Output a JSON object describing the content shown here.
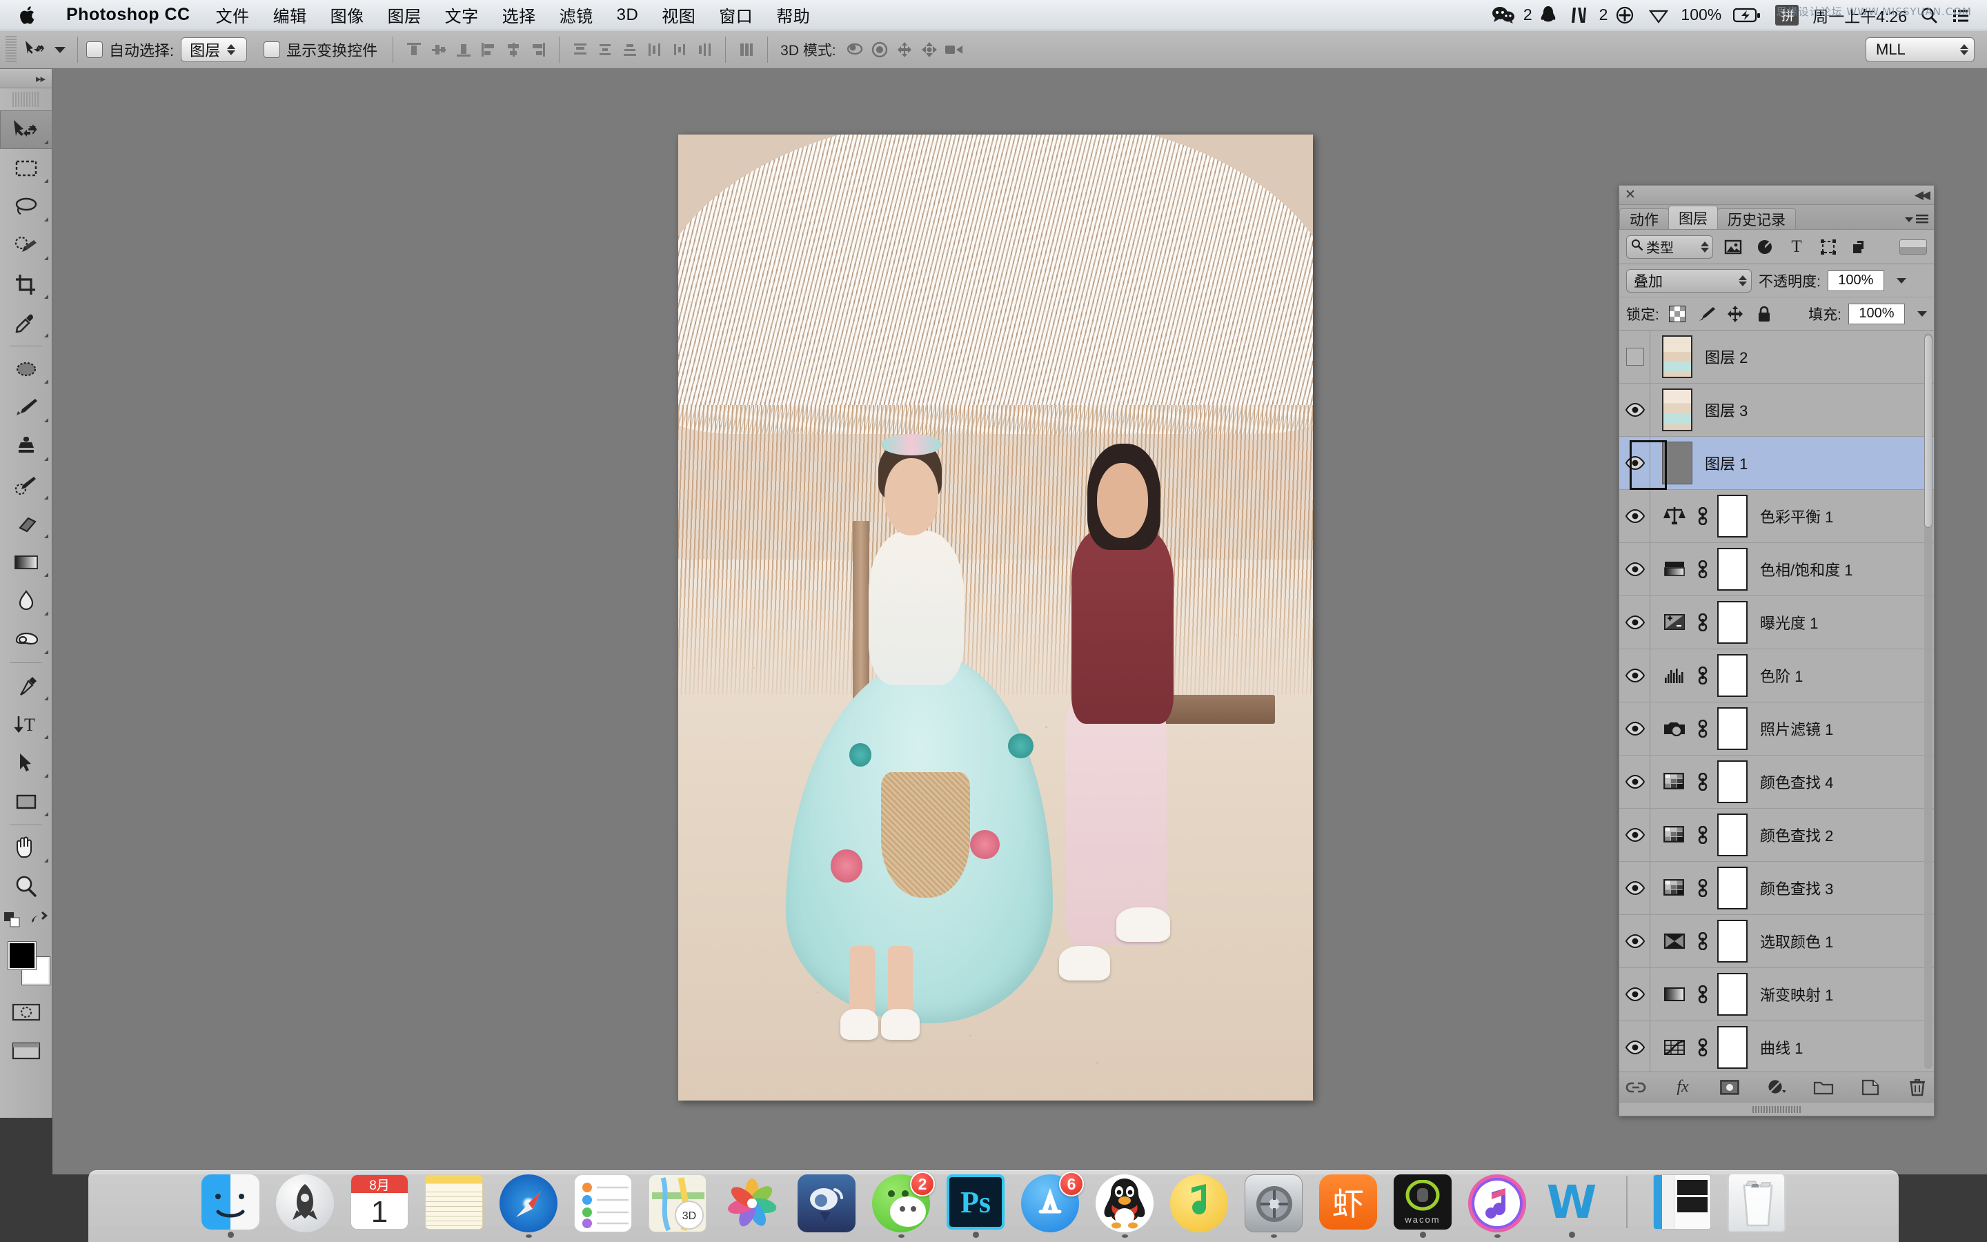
{
  "menubar": {
    "apple_icon": "apple-logo-icon",
    "app_name": "Photoshop CC",
    "menus": [
      "文件",
      "编辑",
      "图像",
      "图层",
      "文字",
      "选择",
      "滤镜",
      "3D",
      "视图",
      "窗口",
      "帮助"
    ],
    "status_items": [
      {
        "icon": "wechat-icon",
        "badge": "2"
      },
      {
        "icon": "bell-icon",
        "badge": ""
      },
      {
        "icon": "sogou-input-icon",
        "badge": "2"
      },
      {
        "icon": "plus-circle-icon",
        "badge": ""
      },
      {
        "icon": "dropbox-icon",
        "badge": ""
      }
    ],
    "battery_percent": "100%",
    "battery_icon": "battery-charging-icon",
    "input_method": "拼",
    "clock": "周一上午4:26",
    "search_icon": "spotlight-search-icon",
    "notification_icon": "notification-center-icon",
    "watermark": "思缘设计论坛 WWW.MISSYUAN.COM"
  },
  "optionsbar": {
    "tool_icon": "move-tool-icon",
    "auto_select_label": "自动选择:",
    "auto_select_value": "图层",
    "show_transform_label": "显示变换控件",
    "align_icons": [
      "align-top-edges-icon",
      "align-vertical-centers-icon",
      "align-bottom-edges-icon",
      "align-left-edges-icon",
      "align-horizontal-centers-icon",
      "align-right-edges-icon"
    ],
    "distribute_icons": [
      "distribute-top-edges-icon",
      "distribute-vertical-centers-icon",
      "distribute-bottom-edges-icon",
      "distribute-left-edges-icon",
      "distribute-horizontal-centers-icon",
      "distribute-right-edges-icon"
    ],
    "auto_align_icon": "auto-align-layers-icon",
    "mode3d_label": "3D 模式:",
    "mode3d_icons": [
      "rotate-3d-icon",
      "roll-3d-icon",
      "pan-3d-icon",
      "slide-3d-icon",
      "scale-3d-icon"
    ],
    "workspace_value": "MLL"
  },
  "toolbar": {
    "collapse_icon": "double-chevron-right-icon",
    "tools": [
      {
        "name": "move-tool",
        "icon": "move-tool-icon",
        "selected": true
      },
      {
        "name": "marquee-tool",
        "icon": "rectangular-marquee-icon",
        "selected": false
      },
      {
        "name": "lasso-tool",
        "icon": "lasso-icon",
        "selected": false
      },
      {
        "name": "quick-selection-tool",
        "icon": "quick-selection-icon",
        "selected": false
      },
      {
        "name": "crop-tool",
        "icon": "crop-icon",
        "selected": false
      },
      {
        "name": "eyedropper-tool",
        "icon": "eyedropper-icon",
        "selected": false
      },
      {
        "name": "healing-brush-tool",
        "icon": "spot-healing-brush-icon",
        "selected": false
      },
      {
        "name": "brush-tool",
        "icon": "brush-icon",
        "selected": false
      },
      {
        "name": "clone-stamp-tool",
        "icon": "clone-stamp-icon",
        "selected": false
      },
      {
        "name": "history-brush-tool",
        "icon": "history-brush-icon",
        "selected": false
      },
      {
        "name": "eraser-tool",
        "icon": "eraser-icon",
        "selected": false
      },
      {
        "name": "gradient-tool",
        "icon": "gradient-icon",
        "selected": false
      },
      {
        "name": "blur-tool",
        "icon": "blur-droplet-icon",
        "selected": false
      },
      {
        "name": "dodge-tool",
        "icon": "dodge-hand-icon",
        "selected": false
      },
      {
        "name": "pen-tool",
        "icon": "pen-icon",
        "selected": false
      },
      {
        "name": "type-tool",
        "icon": "type-vertical-icon",
        "selected": false
      },
      {
        "name": "path-selection-tool",
        "icon": "path-selection-arrow-icon",
        "selected": false
      },
      {
        "name": "rectangle-tool",
        "icon": "rectangle-shape-icon",
        "selected": false
      },
      {
        "name": "hand-tool",
        "icon": "hand-icon",
        "selected": false
      },
      {
        "name": "zoom-tool",
        "icon": "magnifier-icon",
        "selected": false
      }
    ],
    "foreground_color": "#000000",
    "background_color": "#ffffff",
    "swap_icon": "swap-colors-icon",
    "default_icon": "default-colors-icon",
    "quickmask_icon": "quick-mask-icon",
    "screenmode_icon": "screen-mode-icon"
  },
  "panel": {
    "close_icon": "close-icon",
    "collapse_icon": "collapse-panel-icon",
    "menu_icon": "panel-menu-icon",
    "tabs": [
      {
        "label": "动作",
        "active": false
      },
      {
        "label": "图层",
        "active": true
      },
      {
        "label": "历史记录",
        "active": false
      }
    ],
    "filter": {
      "search_icon": "search-icon",
      "kind_value": "类型",
      "icons": [
        "filter-pixel-icon",
        "filter-adjustment-icon",
        "filter-type-icon",
        "filter-shape-icon",
        "filter-smart-object-icon"
      ],
      "toggle_icon": "filter-toggle-icon"
    },
    "blend_mode": "叠加",
    "opacity_label": "不透明度:",
    "opacity_value": "100%",
    "lock_label": "锁定:",
    "lock_icons": [
      "lock-transparent-pixels-icon",
      "lock-image-pixels-icon",
      "lock-position-icon",
      "lock-all-icon"
    ],
    "fill_label": "填充:",
    "fill_value": "100%",
    "layers": [
      {
        "name": "图层 2",
        "visible": false,
        "selected": false,
        "thumb": "photo",
        "has_mask": false,
        "adj_icon": ""
      },
      {
        "name": "图层 3",
        "visible": true,
        "selected": false,
        "thumb": "photo",
        "has_mask": false,
        "adj_icon": ""
      },
      {
        "name": "图层 1",
        "visible": true,
        "selected": true,
        "thumb": "gray",
        "has_mask": false,
        "adj_icon": ""
      },
      {
        "name": "色彩平衡 1",
        "visible": true,
        "selected": false,
        "thumb": "adj",
        "has_mask": true,
        "adj_icon": "color-balance-icon"
      },
      {
        "name": "色相/饱和度 1",
        "visible": true,
        "selected": false,
        "thumb": "adj",
        "has_mask": true,
        "adj_icon": "hue-saturation-icon"
      },
      {
        "name": "曝光度 1",
        "visible": true,
        "selected": false,
        "thumb": "adj",
        "has_mask": true,
        "adj_icon": "exposure-icon"
      },
      {
        "name": "色阶 1",
        "visible": true,
        "selected": false,
        "thumb": "adj",
        "has_mask": true,
        "adj_icon": "levels-icon"
      },
      {
        "name": "照片滤镜 1",
        "visible": true,
        "selected": false,
        "thumb": "adj",
        "has_mask": true,
        "adj_icon": "photo-filter-icon"
      },
      {
        "name": "颜色查找 4",
        "visible": true,
        "selected": false,
        "thumb": "adj",
        "has_mask": true,
        "adj_icon": "color-lookup-icon"
      },
      {
        "name": "颜色查找 2",
        "visible": true,
        "selected": false,
        "thumb": "adj",
        "has_mask": true,
        "adj_icon": "color-lookup-icon"
      },
      {
        "name": "颜色查找 3",
        "visible": true,
        "selected": false,
        "thumb": "adj",
        "has_mask": true,
        "adj_icon": "color-lookup-icon"
      },
      {
        "name": "选取颜色 1",
        "visible": true,
        "selected": false,
        "thumb": "adj",
        "has_mask": true,
        "adj_icon": "selective-color-icon"
      },
      {
        "name": "渐变映射 1",
        "visible": true,
        "selected": false,
        "thumb": "adj",
        "has_mask": true,
        "adj_icon": "gradient-map-icon"
      },
      {
        "name": "曲线 1",
        "visible": true,
        "selected": false,
        "thumb": "adj",
        "has_mask": true,
        "adj_icon": "curves-icon"
      }
    ],
    "footer_icons": [
      "link-layers-icon",
      "add-layer-style-icon",
      "add-layer-mask-icon",
      "new-adjustment-layer-icon",
      "new-group-icon",
      "new-layer-icon",
      "delete-layer-icon"
    ]
  },
  "dock": {
    "items": [
      {
        "name": "finder",
        "label": "Finder",
        "badge": "",
        "running": true
      },
      {
        "name": "launchpad",
        "label": "Launchpad",
        "badge": "",
        "running": false
      },
      {
        "name": "calendar",
        "label": "日历",
        "badge": "",
        "running": false,
        "month": "8月",
        "day": "1"
      },
      {
        "name": "notes",
        "label": "备忘录",
        "badge": "",
        "running": false
      },
      {
        "name": "safari",
        "label": "Safari",
        "badge": "",
        "running": true
      },
      {
        "name": "reminders",
        "label": "提醒事项",
        "badge": "",
        "running": false
      },
      {
        "name": "maps",
        "label": "地图",
        "badge": "",
        "running": false
      },
      {
        "name": "photos",
        "label": "照片",
        "badge": "",
        "running": false
      },
      {
        "name": "weibo",
        "label": "微博",
        "badge": "",
        "running": false
      },
      {
        "name": "wechat",
        "label": "微信",
        "badge": "2",
        "running": true
      },
      {
        "name": "photoshop",
        "label": "Ps",
        "badge": "",
        "running": true
      },
      {
        "name": "app-store",
        "label": "App Store",
        "badge": "6",
        "running": false
      },
      {
        "name": "qq",
        "label": "QQ",
        "badge": "",
        "running": true
      },
      {
        "name": "qq-music",
        "label": "QQ音乐",
        "badge": "",
        "running": false
      },
      {
        "name": "system-preferences",
        "label": "系统偏好设置",
        "badge": "",
        "running": true
      },
      {
        "name": "xiami-music",
        "label": "虾",
        "badge": "",
        "running": false
      },
      {
        "name": "wacom",
        "label": "wacom",
        "badge": "",
        "running": true
      },
      {
        "name": "itunes",
        "label": "iTunes",
        "badge": "",
        "running": true
      },
      {
        "name": "wps-word",
        "label": "W",
        "badge": "",
        "running": true
      }
    ],
    "minimized": [
      {
        "name": "qq-window",
        "label": "QQ 窗口"
      }
    ],
    "trash": {
      "name": "trash",
      "label": "废纸篓"
    }
  },
  "canvas": {
    "zoom_background": "#7b7b7b",
    "document_title": ""
  }
}
